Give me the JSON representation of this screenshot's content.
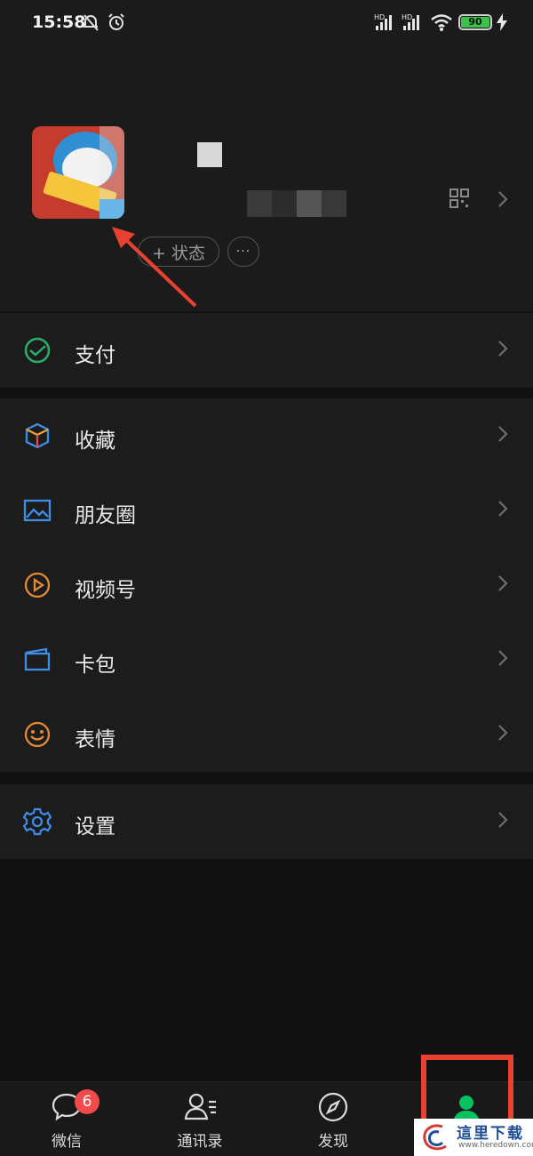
{
  "status_bar": {
    "time": "15:58",
    "battery": "90",
    "icons": [
      "bell-off-icon",
      "alarm-icon",
      "hd-signal-icon",
      "hd-signal-icon",
      "wifi-icon",
      "battery-icon",
      "charging-icon"
    ],
    "signal_tag": "HD"
  },
  "profile": {
    "status_button": "+ 状态",
    "more_button": "···"
  },
  "menu": {
    "group1": [
      {
        "label": "支付",
        "icon": "pay-icon",
        "color": "#2aae67"
      }
    ],
    "group2": [
      {
        "label": "收藏",
        "icon": "favorites-cube-icon",
        "color": "#3d8ee6"
      },
      {
        "label": "朋友圈",
        "icon": "moments-picture-icon",
        "color": "#3d8ee6"
      },
      {
        "label": "视频号",
        "icon": "channels-play-icon",
        "color": "#e38a33"
      },
      {
        "label": "卡包",
        "icon": "card-wallet-icon",
        "color": "#3d8ee6"
      },
      {
        "label": "表情",
        "icon": "sticker-smile-icon",
        "color": "#e38a33"
      }
    ],
    "group3": [
      {
        "label": "设置",
        "icon": "settings-gear-icon",
        "color": "#3d8ee6"
      }
    ]
  },
  "bottom_nav": {
    "tabs": [
      {
        "label": "微信",
        "icon": "chat-bubble-icon",
        "badge": "6"
      },
      {
        "label": "通讯录",
        "icon": "contacts-icon"
      },
      {
        "label": "发现",
        "icon": "compass-icon"
      },
      {
        "label": "",
        "icon": "me-person-icon",
        "active": true
      }
    ]
  },
  "watermark": {
    "text": "這里下载",
    "url": "www.heredown.com"
  },
  "colors": {
    "accent_green": "#07c160",
    "annotation_red": "#e8412f",
    "badge_red": "#f04a4a"
  }
}
